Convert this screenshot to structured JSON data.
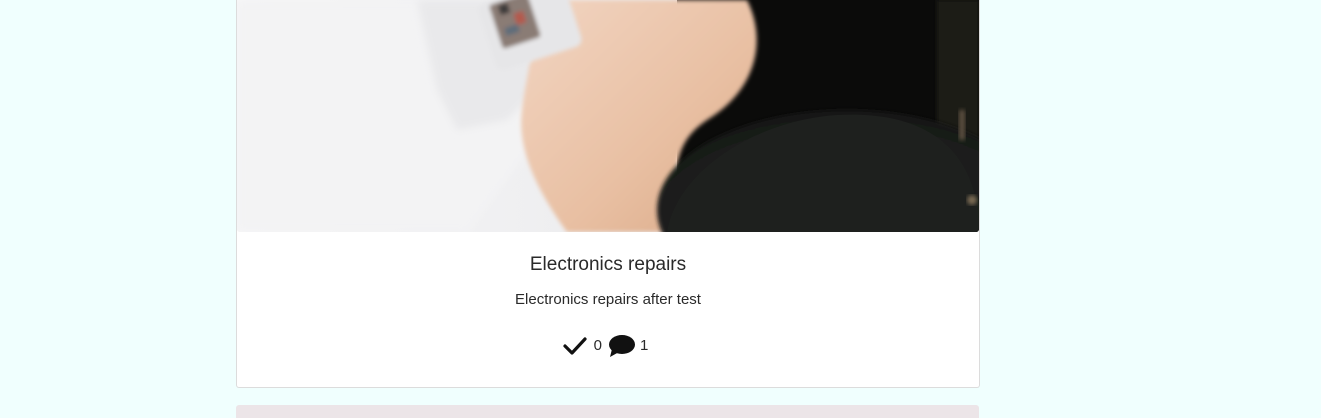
{
  "post": {
    "image": {
      "alt": "",
      "icon": "post-photo"
    },
    "title": "Electronics repairs",
    "content": "Electronics repairs after test",
    "stats": {
      "likes_icon": "check-icon",
      "likes_count": "0",
      "comments_icon": "comment-bubble-icon",
      "comments_count": "1"
    }
  },
  "colors": {
    "page_background": "#f0fffe",
    "card_background": "#ffffff",
    "next_card_background": "#ece5e8",
    "text": "#2a2a2a"
  }
}
